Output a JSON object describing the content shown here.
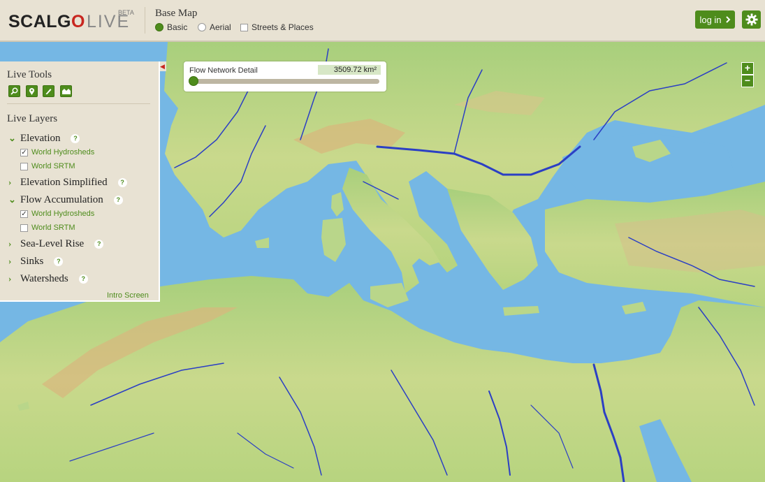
{
  "header": {
    "logo_scalgo": "SCALGO",
    "logo_live": "LIVE",
    "beta_badge": "BETA",
    "basemap_title": "Base Map",
    "basemap_options": [
      {
        "label": "Basic",
        "selected": true
      },
      {
        "label": "Aerial",
        "selected": false
      },
      {
        "label": "Streets & Places",
        "checked": false
      }
    ],
    "login_label": "log in",
    "login_icon": "chevron-right-icon",
    "settings_icon": "gear-icon"
  },
  "panel": {
    "tools_title": "Live Tools",
    "tools": [
      "search-icon",
      "map-pin-icon",
      "pencil-icon",
      "watershed-icon"
    ],
    "layers_title": "Live Layers",
    "layers": [
      {
        "label": "Elevation",
        "expanded": true,
        "sublayers": [
          {
            "label": "World Hydrosheds",
            "checked": true
          },
          {
            "label": "World SRTM",
            "checked": false
          }
        ]
      },
      {
        "label": "Elevation Simplified",
        "expanded": false
      },
      {
        "label": "Flow Accumulation",
        "expanded": true,
        "sublayers": [
          {
            "label": "World Hydrosheds",
            "checked": true
          },
          {
            "label": "World SRTM",
            "checked": false
          }
        ]
      },
      {
        "label": "Sea-Level Rise",
        "expanded": false
      },
      {
        "label": "Sinks",
        "expanded": false
      },
      {
        "label": "Watersheds",
        "expanded": false
      }
    ],
    "help_symbol": "?",
    "intro_link": "Intro Screen"
  },
  "flow_network": {
    "label": "Flow Network Detail",
    "value": "3509.72 km²",
    "slider_position": 0
  },
  "zoom": {
    "in": "+",
    "out": "−"
  },
  "colors": {
    "accent": "#4e8c1c",
    "panel": "#e8e2d3",
    "sea": "#75b7e4",
    "river": "#2b3fc4",
    "logo_red": "#c8261f"
  }
}
